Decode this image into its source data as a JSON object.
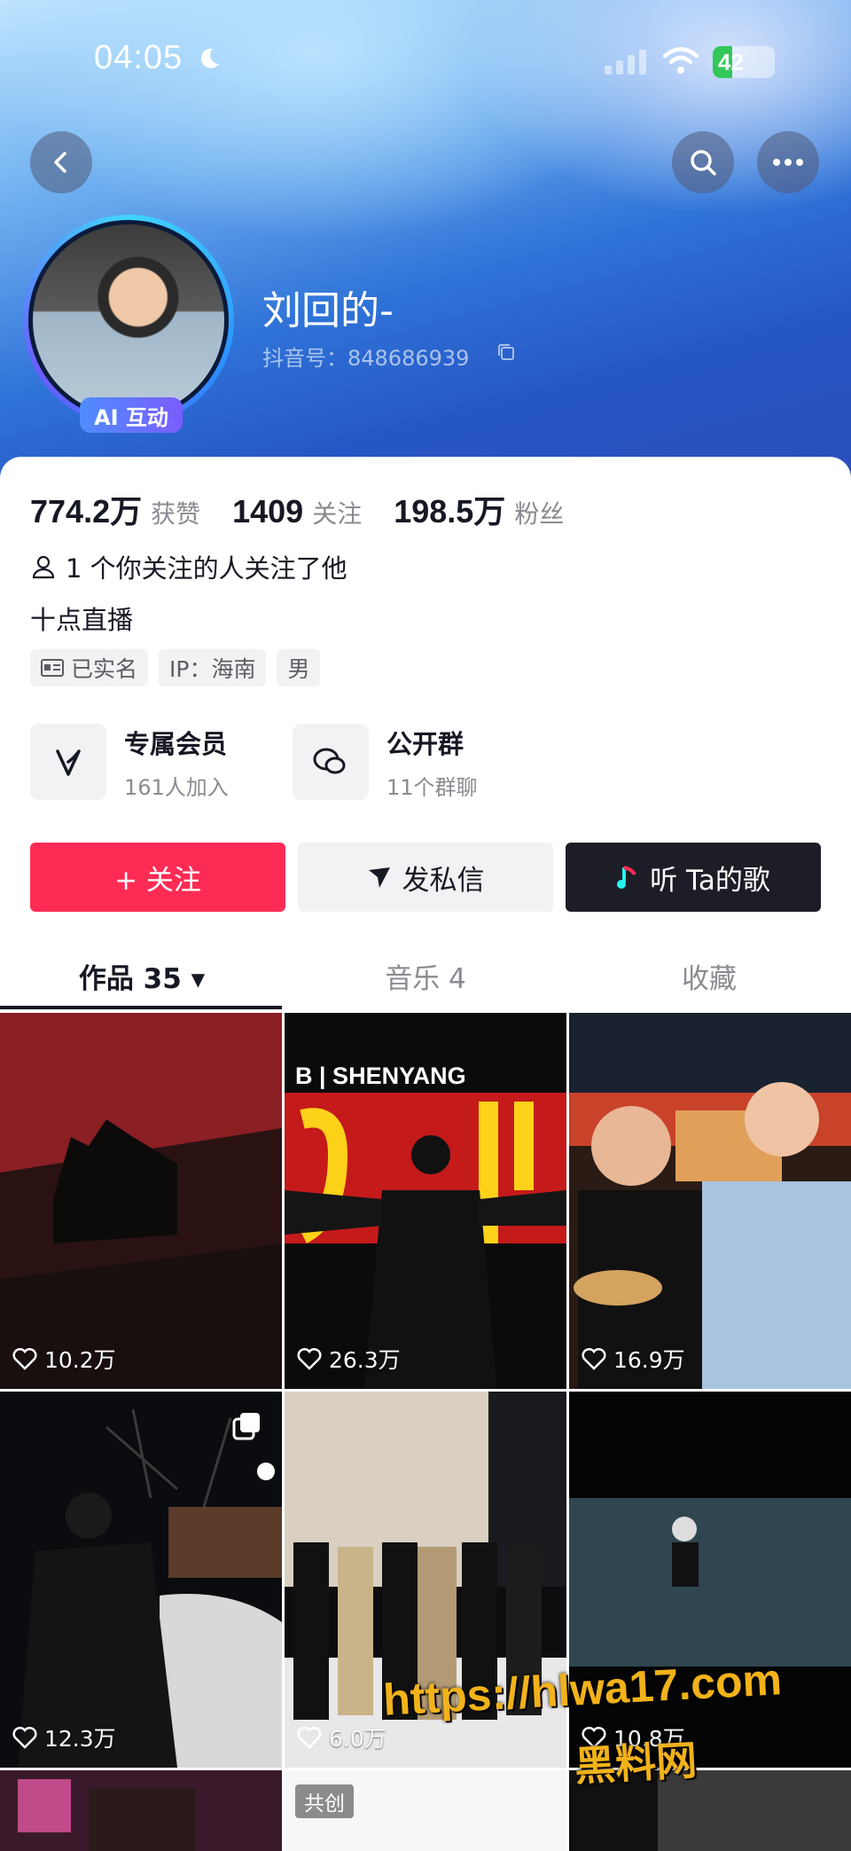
{
  "status_bar": {
    "time": "04:05",
    "battery": "42"
  },
  "profile": {
    "name": "刘回的-",
    "douyin_id": "抖音号：848686939",
    "ai_badge": "AI 互动"
  },
  "stats": [
    {
      "value": "774.2万",
      "label": "获赞"
    },
    {
      "value": "1409",
      "label": "关注"
    },
    {
      "value": "198.5万",
      "label": "粉丝"
    }
  ],
  "mutual_follow": "1 个你关注的人关注了他",
  "bio": "十点直播",
  "tags": {
    "verified": "已实名",
    "ip": "IP：海南",
    "gender": "男"
  },
  "features": [
    {
      "title": "专属会员",
      "subtitle": "161人加入",
      "icon": "v-logo-icon"
    },
    {
      "title": "公开群",
      "subtitle": "11个群聊",
      "icon": "group-chat-icon"
    }
  ],
  "actions": {
    "follow": "+ 关注",
    "message": "发私信",
    "song": "听 Ta的歌"
  },
  "tabs": [
    {
      "label": "作品 35 ▾",
      "active": true
    },
    {
      "label": "音乐 4",
      "active": false
    },
    {
      "label": "收藏",
      "active": false
    }
  ],
  "videos": [
    {
      "likes": "10.2万"
    },
    {
      "likes": "26.3万"
    },
    {
      "likes": "16.9万"
    },
    {
      "likes": "12.3万"
    },
    {
      "likes": "6.0万"
    },
    {
      "likes": "10.8万"
    }
  ],
  "video2_sign": "B | SHENYANG",
  "cochuang_badge": "共创",
  "watermark": {
    "url": "https://hlwa17.com",
    "name": "黑料网"
  },
  "colors": {
    "follow": "#fe2c55",
    "dark_button": "#1c1d26"
  }
}
